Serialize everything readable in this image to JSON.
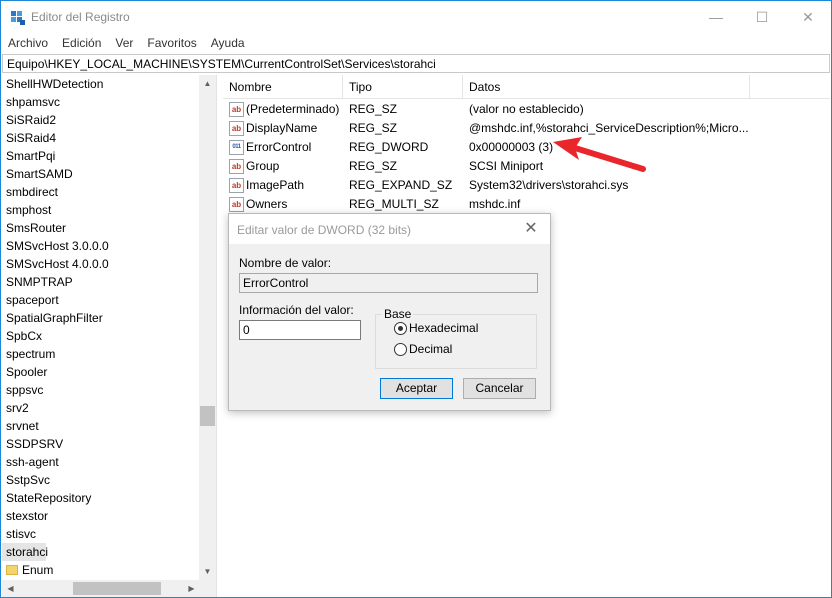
{
  "window": {
    "title": "Editor del Registro",
    "accent": "#1e86d7",
    "min_glyph": "—",
    "max_glyph": "☐",
    "close_glyph": "✕"
  },
  "menu": [
    "Archivo",
    "Edición",
    "Ver",
    "Favoritos",
    "Ayuda"
  ],
  "address": "Equipo\\HKEY_LOCAL_MACHINE\\SYSTEM\\CurrentControlSet\\Services\\storahci",
  "tree": {
    "items": [
      "ShellHWDetection",
      "shpamsvc",
      "SiSRaid2",
      "SiSRaid4",
      "SmartPqi",
      "SmartSAMD",
      "smbdirect",
      "smphost",
      "SmsRouter",
      "SMSvcHost 3.0.0.0",
      "SMSvcHost 4.0.0.0",
      "SNMPTRAP",
      "spaceport",
      "SpatialGraphFilter",
      "SpbCx",
      "spectrum",
      "Spooler",
      "sppsvc",
      "srv2",
      "srvnet",
      "SSDPSRV",
      "ssh-agent",
      "SstpSvc",
      "StateRepository",
      "stexstor",
      "stisvc",
      "storahci"
    ],
    "selected": "storahci",
    "child": "Enum"
  },
  "list": {
    "headers": {
      "name": "Nombre",
      "type": "Tipo",
      "data": "Datos"
    },
    "rows": [
      {
        "icon": "ab",
        "name": "(Predeterminado)",
        "type": "REG_SZ",
        "data": "(valor no establecido)"
      },
      {
        "icon": "ab",
        "name": "DisplayName",
        "type": "REG_SZ",
        "data": "@mshdc.inf,%storahci_ServiceDescription%;Micro..."
      },
      {
        "icon": "011",
        "name": "ErrorControl",
        "type": "REG_DWORD",
        "data": "0x00000003 (3)"
      },
      {
        "icon": "ab",
        "name": "Group",
        "type": "REG_SZ",
        "data": "SCSI Miniport"
      },
      {
        "icon": "ab",
        "name": "ImagePath",
        "type": "REG_EXPAND_SZ",
        "data": "System32\\drivers\\storahci.sys"
      },
      {
        "icon": "ab",
        "name": "Owners",
        "type": "REG_MULTI_SZ",
        "data": "mshdc.inf"
      }
    ],
    "partial_text": ")"
  },
  "annotation_arrow_color": "#e8262b",
  "dialog": {
    "title": "Editar valor de DWORD (32 bits)",
    "name_label": "Nombre de valor:",
    "name_value": "ErrorControl",
    "data_label": "Información del valor:",
    "data_value": "0",
    "base_label": "Base",
    "radio_hex": "Hexadecimal",
    "radio_dec": "Decimal",
    "selected_base": "Hexadecimal",
    "ok_label": "Aceptar",
    "cancel_label": "Cancelar",
    "close_glyph": "✕"
  }
}
